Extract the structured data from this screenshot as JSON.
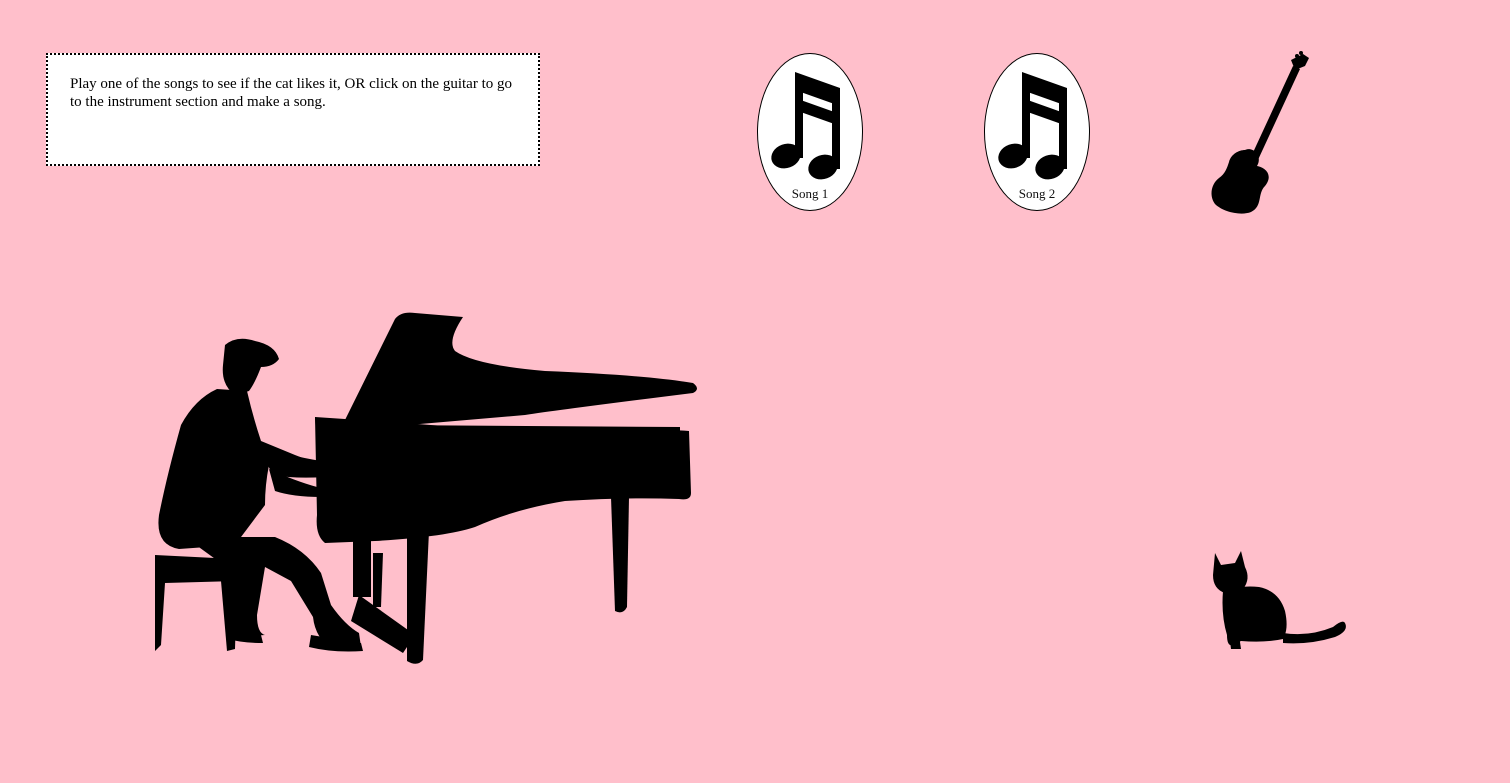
{
  "instructions": {
    "text": "Play one of the songs to see if the cat likes it, OR click on the guitar to go to the instrument section and make a song."
  },
  "songs": [
    {
      "label": "Song 1",
      "icon": "music-note-icon"
    },
    {
      "label": "Song 2",
      "icon": "music-note-icon"
    }
  ],
  "icons": {
    "guitar": "guitar-icon",
    "piano": "pianist-silhouette",
    "cat": "cat-icon"
  },
  "colors": {
    "background": "#ffbfcb",
    "silhouette": "#000000",
    "panel": "#ffffff"
  }
}
